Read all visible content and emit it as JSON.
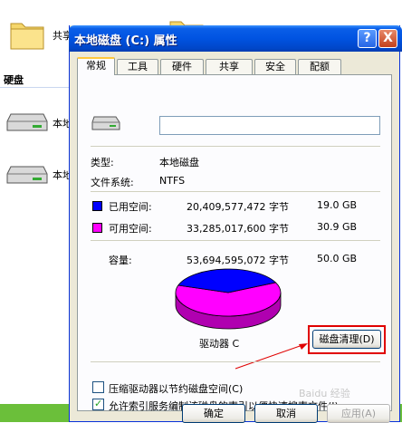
{
  "background": {
    "shared_folder_label": "共享",
    "section_header": "硬盘",
    "drive_label_1": "本地",
    "drive_label_2": "本地"
  },
  "dialog": {
    "title": "本地磁盘 (C:) 属性",
    "help_button": "?",
    "close_button": "X",
    "tabs": [
      "常规",
      "工具",
      "硬件",
      "共享",
      "安全",
      "配额"
    ],
    "active_tab": "常规",
    "volume_name": "",
    "type_label": "类型:",
    "type_value": "本地磁盘",
    "fs_label": "文件系统:",
    "fs_value": "NTFS",
    "used_label": "已用空间:",
    "used_bytes": "20,409,577,472 字节",
    "used_size": "19.0 GB",
    "free_label": "可用空间:",
    "free_bytes": "33,285,017,600 字节",
    "free_size": "30.9 GB",
    "capacity_label": "容量:",
    "capacity_bytes": "53,694,595,072 字节",
    "capacity_size": "50.0 GB",
    "used_fraction": 0.38,
    "used_color": "#0000ff",
    "free_color": "#ff00ff",
    "drive_caption": "驱动器 C",
    "cleanup_button": "磁盘清理(D)",
    "compress_checkbox": "压缩驱动器以节约磁盘空间(C)",
    "compress_checked": false,
    "index_checkbox": "允许索引服务编制该磁盘的索引以便快速搜索文件(I)",
    "index_checked": true,
    "ok_button": "确定",
    "cancel_button": "取消",
    "apply_button": "应用(A)"
  }
}
